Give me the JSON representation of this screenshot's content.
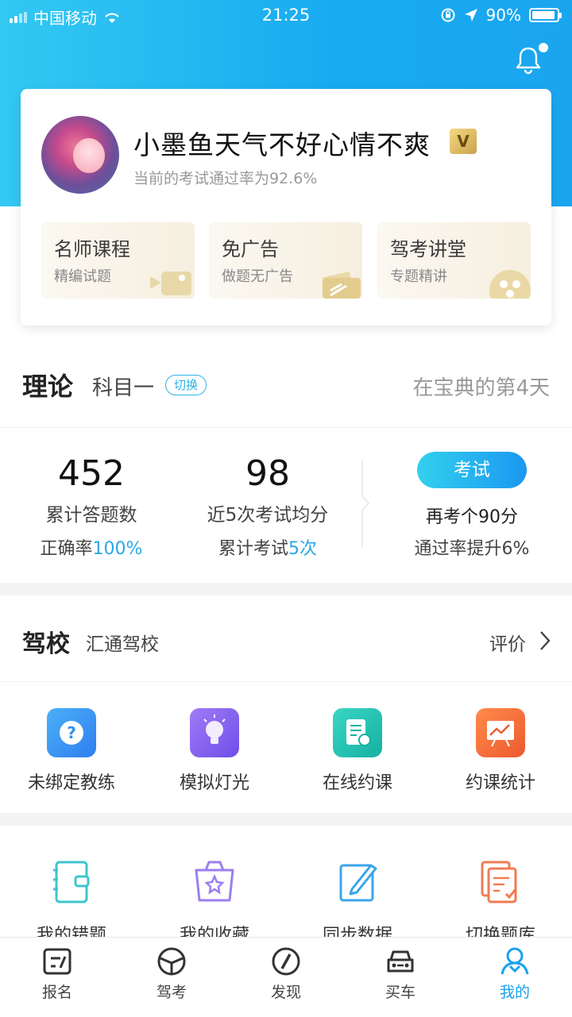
{
  "status_bar": {
    "carrier": "中国移动",
    "time": "21:25",
    "battery": "90%"
  },
  "profile": {
    "username": "小墨鱼天气不好心情不爽",
    "vip_label": "V",
    "pass_rate_text": "当前的考试通过率为92.6%"
  },
  "features": [
    {
      "title": "名师课程",
      "subtitle": "精编试题",
      "icon": "video-camera-icon"
    },
    {
      "title": "免广告",
      "subtitle": "做题无广告",
      "icon": "ticket-icon"
    },
    {
      "title": "驾考讲堂",
      "subtitle": "专题精讲",
      "icon": "film-reel-icon"
    }
  ],
  "theory": {
    "title": "理论",
    "subject": "科目一",
    "switch_label": "切换",
    "days_text": "在宝典的第4天"
  },
  "stats": {
    "answered": {
      "value": "452",
      "label": "累计答题数",
      "sub_prefix": "正确率",
      "sub_value": "100%"
    },
    "average": {
      "value": "98",
      "label": "近5次考试均分",
      "sub_prefix": "累计考试",
      "sub_value": "5次"
    },
    "exam": {
      "button": "考试",
      "line1": "再考个90分",
      "line2": "通过率提升6%"
    }
  },
  "school": {
    "title": "驾校",
    "name": "汇通驾校",
    "review_label": "评价"
  },
  "school_tools": [
    {
      "label": "未绑定教练",
      "icon": "question-icon",
      "color": "#2f8ff0"
    },
    {
      "label": "模拟灯光",
      "icon": "lightbulb-icon",
      "color": "#8b63f0"
    },
    {
      "label": "在线约课",
      "icon": "schedule-icon",
      "color": "#21c1b3"
    },
    {
      "label": "约课统计",
      "icon": "chart-icon",
      "color": "#f06a3c"
    }
  ],
  "study_tools": [
    {
      "label": "我的错题",
      "icon": "notebook-icon"
    },
    {
      "label": "我的收藏",
      "icon": "star-bag-icon"
    },
    {
      "label": "同步数据",
      "icon": "edit-sync-icon"
    },
    {
      "label": "切换题库",
      "icon": "question-bank-icon"
    }
  ],
  "tabs": [
    {
      "label": "报名",
      "icon": "register-icon",
      "active": false
    },
    {
      "label": "驾考",
      "icon": "steering-wheel-icon",
      "active": false
    },
    {
      "label": "发现",
      "icon": "compass-icon",
      "active": false
    },
    {
      "label": "买车",
      "icon": "car-icon",
      "active": false
    },
    {
      "label": "我的",
      "icon": "user-icon",
      "active": true
    }
  ],
  "colors": {
    "accent": "#19a2ec",
    "hero_start": "#33c8f2",
    "hero_end": "#1aa6ef"
  }
}
